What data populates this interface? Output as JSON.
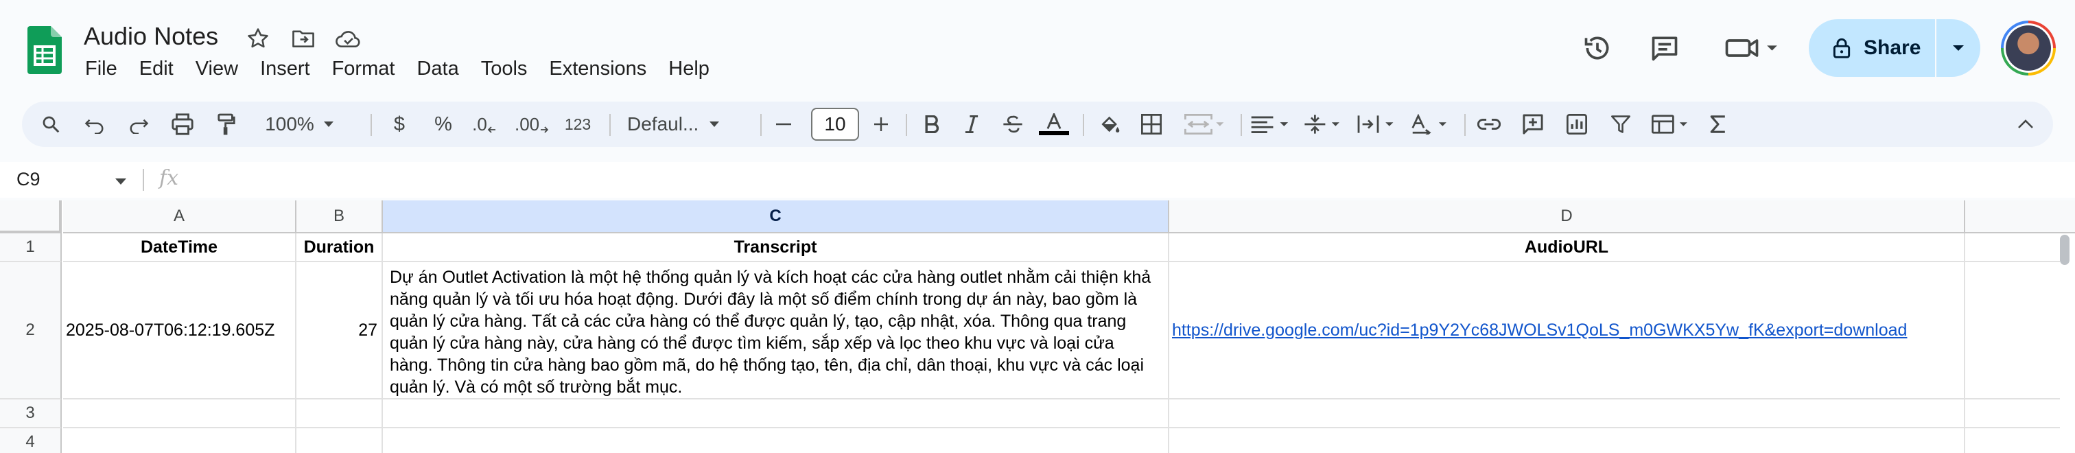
{
  "app": {
    "doc_title": "Audio Notes",
    "menu": [
      "File",
      "Edit",
      "View",
      "Insert",
      "Format",
      "Data",
      "Tools",
      "Extensions",
      "Help"
    ],
    "share_label": "Share",
    "colors": {
      "sheets_green": "#0f9d58",
      "share_bg": "#c2e7ff",
      "link": "#1155cc",
      "selected_col": "#d3e3fd"
    }
  },
  "toolbar": {
    "zoom": "100%",
    "currency": "$",
    "percent": "%",
    "decrease_decimal": ".0",
    "increase_decimal": ".00",
    "number_format": "123",
    "font": "Defaul...",
    "font_size": "10"
  },
  "formula_bar": {
    "cell_ref": "C9",
    "fx": "fx",
    "value": ""
  },
  "sheet": {
    "columns": [
      "A",
      "B",
      "C",
      "D"
    ],
    "selected_column": "C",
    "rows": [
      "1",
      "2",
      "3",
      "4"
    ],
    "header_row": [
      "DateTime",
      "Duration",
      "Transcript",
      "AudioURL"
    ],
    "data": [
      {
        "datetime": "2025-08-07T06:12:19.605Z",
        "duration": "27",
        "transcript": "Dự án Outlet Activation là một hệ thống quản lý và kích hoạt các cửa hàng outlet nhằm cải thiện khả năng quản lý và tối ưu hóa hoạt động. Dưới đây là một số điểm chính trong dự án này, bao gồm là quản lý cửa hàng. Tất cả các cửa hàng có thể được quản lý, tạo, cập nhật, xóa. Thông qua trang quản lý cửa hàng này, cửa hàng có thể được tìm kiếm, sắp xếp và lọc theo khu vực và loại cửa hàng. Thông tin cửa hàng bao gồm mã, do hệ thống tạo, tên, địa chỉ, dân thoại, khu vực và các loại quản lý. Và có một số trường bắt mục.",
        "audio_url": "https://drive.google.com/uc?id=1p9Y2Yc68JWOLSv1QoLS_m0GWKX5Yw_fK&export=download"
      }
    ]
  }
}
